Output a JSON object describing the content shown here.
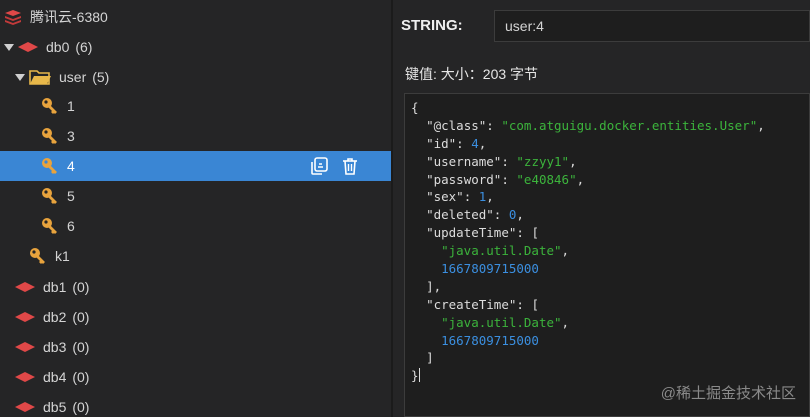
{
  "tree": {
    "connection": {
      "label": "腾讯云-6380"
    },
    "db0": {
      "name": "db0",
      "count": "(6)"
    },
    "folder": {
      "name": "user",
      "count": "(5)"
    },
    "keys": [
      "1",
      "3",
      "4",
      "5",
      "6"
    ],
    "selected_key": "4",
    "root_key": "k1",
    "other_dbs": [
      {
        "name": "db1",
        "count": "(0)"
      },
      {
        "name": "db2",
        "count": "(0)"
      },
      {
        "name": "db3",
        "count": "(0)"
      },
      {
        "name": "db4",
        "count": "(0)"
      },
      {
        "name": "db5",
        "count": "(0)"
      }
    ],
    "row_actions": {
      "copy_icon": "copy-link-icon",
      "delete_icon": "trash-icon"
    }
  },
  "detail": {
    "type_label": "STRING:",
    "key_value": "user:4",
    "value_meta": "键值: 大小：203 字节",
    "json_lines": [
      "{",
      "  \"@class\": \"com.atguigu.docker.entities.User\",",
      "  \"id\": 4,",
      "  \"username\": \"zzyy1\",",
      "  \"password\": \"e40846\",",
      "  \"sex\": 1,",
      "  \"deleted\": 0,",
      "  \"updateTime\": [",
      "    \"java.util.Date\",",
      "    1667809715000",
      "  ],",
      "  \"createTime\": [",
      "    \"java.util.Date\",",
      "    1667809715000",
      "  ]",
      "}"
    ]
  },
  "watermark": "@稀土掘金技术社区",
  "colors": {
    "background": "#252526",
    "selection": "#3a86d4",
    "db_icon": "#e04848",
    "folder_icon": "#e8b84a",
    "key_icon": "#e8a33d",
    "json_string": "#3cb43c",
    "json_number": "#3b8fe0"
  }
}
